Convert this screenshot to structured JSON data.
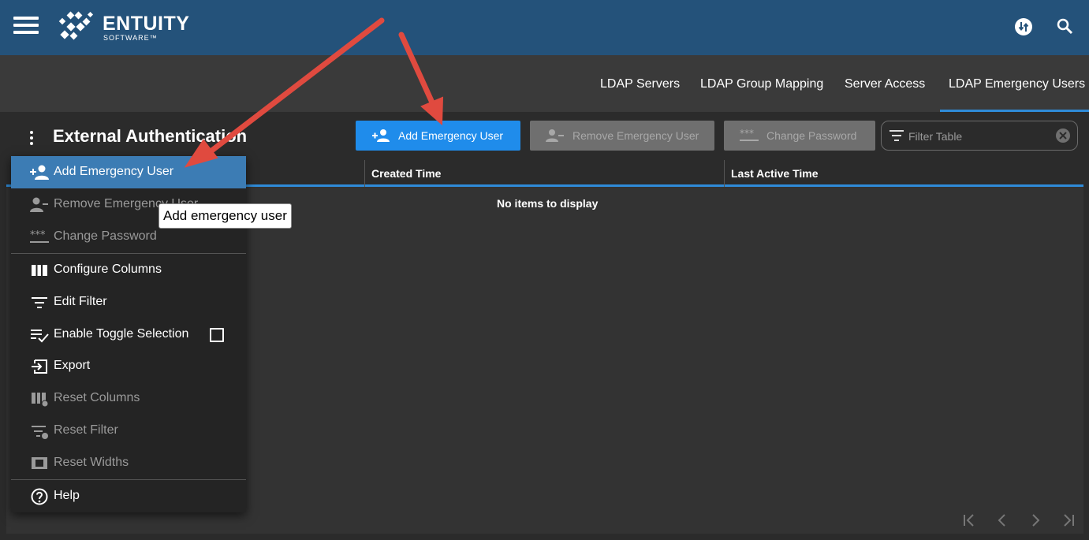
{
  "header": {
    "logo_word": "ENTUITY",
    "logo_sub": "SOFTWARE™"
  },
  "tabs": [
    {
      "label": "LDAP Servers",
      "active": false
    },
    {
      "label": "LDAP Group Mapping",
      "active": false
    },
    {
      "label": "Server Access",
      "active": false
    },
    {
      "label": "LDAP Emergency Users",
      "active": true
    }
  ],
  "page": {
    "title": "External Authentication"
  },
  "toolbar": {
    "add_label": "Add Emergency User",
    "remove_label": "Remove Emergency User",
    "change_password_label": "Change Password",
    "filter_placeholder": "Filter Table"
  },
  "table": {
    "columns": [
      "",
      "Created Time",
      "Last Active Time"
    ],
    "empty_message": "No items to display"
  },
  "menu": {
    "items": [
      {
        "label": "Add Emergency User",
        "enabled": true,
        "highlighted": true
      },
      {
        "label": "Remove Emergency User",
        "enabled": false
      },
      {
        "label": "Change Password",
        "enabled": false
      },
      {
        "label": "Configure Columns",
        "enabled": true
      },
      {
        "label": "Edit Filter",
        "enabled": true
      },
      {
        "label": "Enable Toggle Selection",
        "enabled": true,
        "checked": false
      },
      {
        "label": "Export",
        "enabled": true
      },
      {
        "label": "Reset Columns",
        "enabled": false
      },
      {
        "label": "Reset Filter",
        "enabled": false
      },
      {
        "label": "Reset Widths",
        "enabled": false
      },
      {
        "label": "Help",
        "enabled": true
      }
    ]
  },
  "tooltip": {
    "text": "Add emergency user"
  },
  "colors": {
    "header_bg": "#24527a",
    "accent": "#1f8ceb",
    "menu_highlight": "#3c7cb4",
    "annotation_arrow": "#e04a3f"
  }
}
